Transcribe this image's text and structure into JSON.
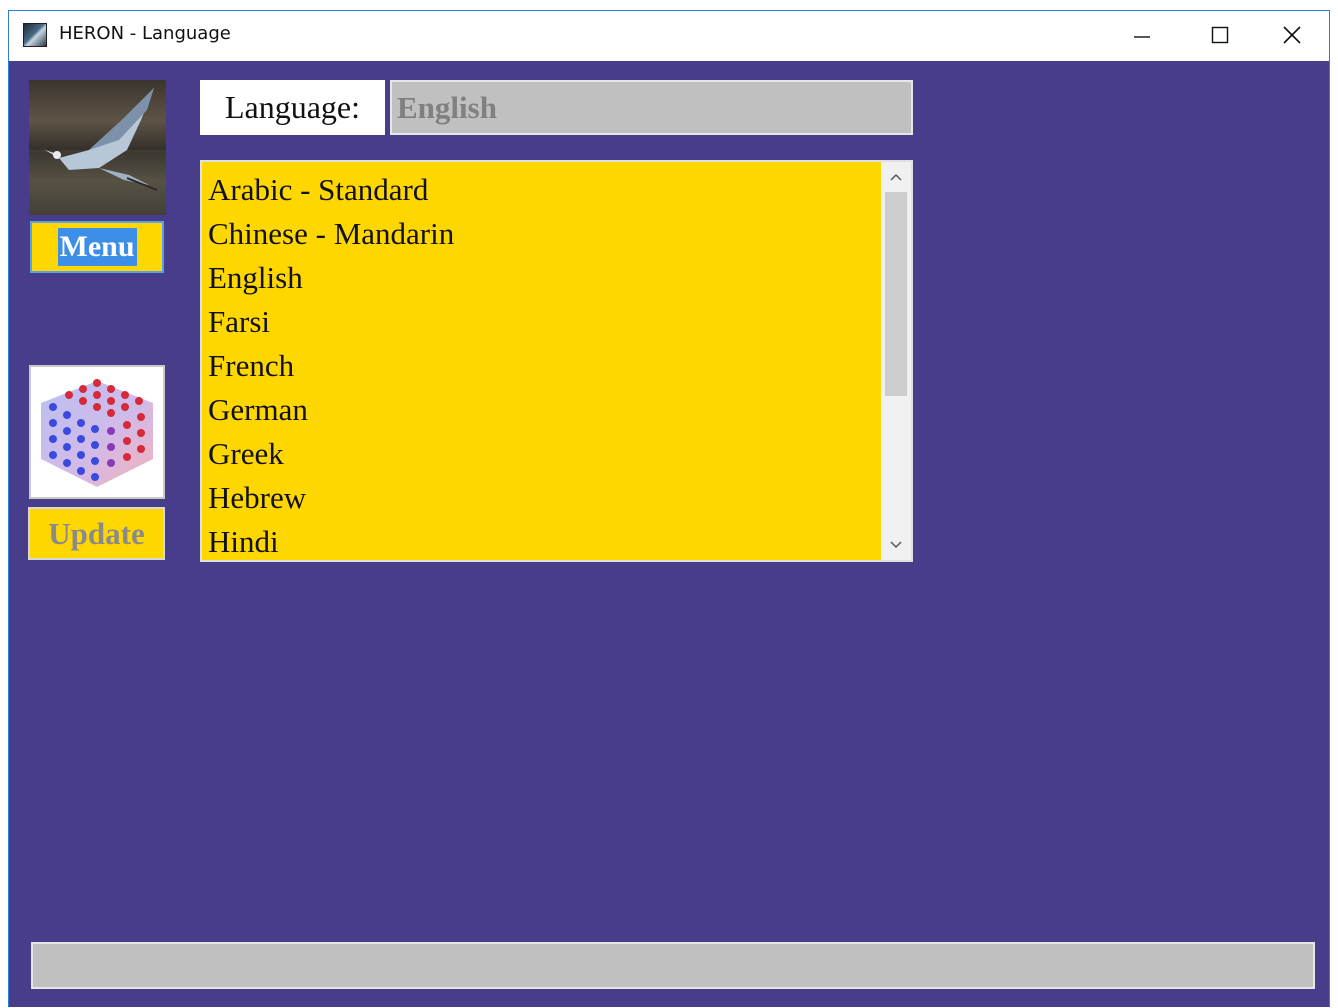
{
  "window": {
    "title": "HERON - Language",
    "icon": "heron-app-icon",
    "controls": [
      "minimize-icon",
      "maximize-icon",
      "close-icon"
    ]
  },
  "sidebar": {
    "heron_image": "heron-bird-photo",
    "menu_label": "Menu",
    "cube_image": "molecule-cube-icon",
    "update_label": "Update"
  },
  "language": {
    "label": "Language:",
    "current_value": "English"
  },
  "language_list": {
    "items": [
      "Arabic - Standard",
      "Chinese - Mandarin",
      "English",
      "Farsi",
      "French",
      "German",
      "Greek",
      "Hebrew",
      "Hindi"
    ]
  },
  "status_bar": {
    "text": ""
  },
  "colors": {
    "background": "#483d8b",
    "list_background": "#ffd700",
    "field_background": "#c0c0c0",
    "menu_highlight": "#3c8ee6"
  }
}
